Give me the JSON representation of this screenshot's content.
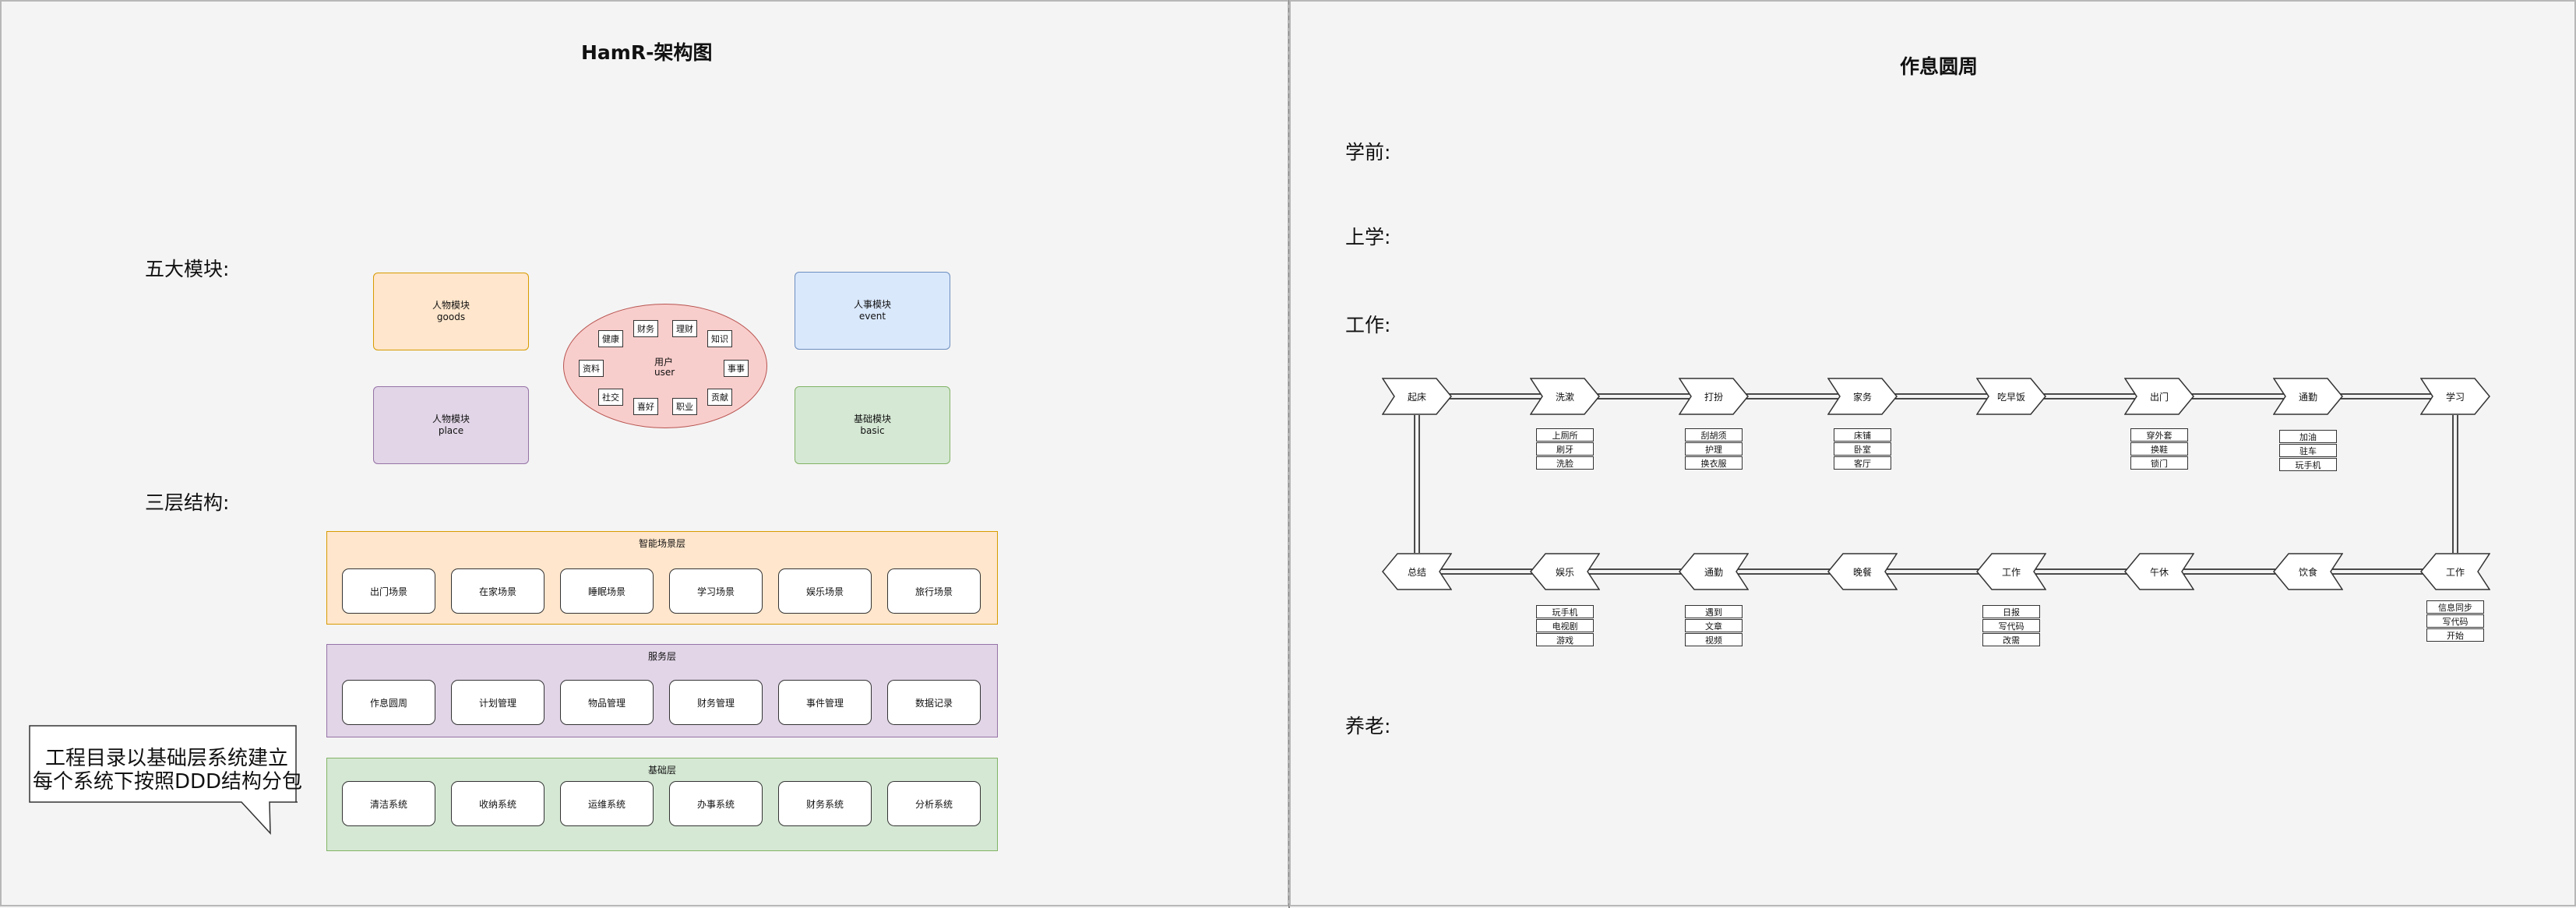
{
  "left_title": "HamR-架构图",
  "right_title": "作息圆周",
  "sections": {
    "modules": "五大模块:",
    "layers": "三层结构:",
    "pre_school": "学前:",
    "school": "上学:",
    "work": "工作:",
    "retire": "养老:"
  },
  "modules": {
    "goods": {
      "name": "人物模块",
      "sub": "goods"
    },
    "place": {
      "name": "人物模块",
      "sub": "place"
    },
    "event": {
      "name": "人事模块",
      "sub": "event"
    },
    "basic": {
      "name": "基础模块",
      "sub": "basic"
    },
    "user": {
      "name": "用户",
      "sub": "user"
    },
    "user_tags": [
      "健康",
      "财务",
      "理财",
      "知识",
      "资料",
      "事事",
      "社交",
      "喜好",
      "职业",
      "贡献"
    ]
  },
  "layers": {
    "scene": {
      "title": "智能场景层",
      "items": [
        "出门场景",
        "在家场景",
        "睡眠场景",
        "学习场景",
        "娱乐场景",
        "旅行场景"
      ]
    },
    "service": {
      "title": "服务层",
      "items": [
        "作息圆周",
        "计划管理",
        "物品管理",
        "财务管理",
        "事件管理",
        "数据记录"
      ]
    },
    "base": {
      "title": "基础层",
      "items": [
        "清洁系统",
        "收纳系统",
        "运维系统",
        "办事系统",
        "财务系统",
        "分析系统"
      ]
    }
  },
  "callout": {
    "line1": "工程目录以基础层系统建立",
    "line2": "每个系统下按照DDD结构分包"
  },
  "cycle": {
    "top": [
      "起床",
      "洗漱",
      "打扮",
      "家务",
      "吃早饭",
      "出门",
      "通勤",
      "学习"
    ],
    "bottom": [
      "总结",
      "娱乐",
      "通勤",
      "晚餐",
      "工作",
      "午休",
      "饮食",
      "工作"
    ],
    "top_tags": {
      "洗漱": [
        "上厕所",
        "刷牙",
        "洗脸"
      ],
      "打扮": [
        "刮胡须",
        "护理",
        "换衣服"
      ],
      "家务": [
        "床铺",
        "卧室",
        "客厅"
      ],
      "出门": [
        "穿外套",
        "换鞋",
        "锁门"
      ],
      "通勤": [
        "加油",
        "驻车",
        "玩手机"
      ]
    },
    "bottom_tags": {
      "娱乐": [
        "玩手机",
        "电视剧",
        "游戏"
      ],
      "通勤": [
        "遇到",
        "文章",
        "视频"
      ],
      "工作": [
        "日报",
        "写代码",
        "改需"
      ],
      "工作2": [
        "信息同步",
        "写代码",
        "开始"
      ]
    }
  },
  "colors": {
    "goods_fill": "#ffe6cc",
    "goods_stroke": "#d79b00",
    "place_fill": "#e1d5e7",
    "place_stroke": "#9673a6",
    "event_fill": "#dae8fc",
    "event_stroke": "#6c8ebf",
    "basic_fill": "#d5e8d4",
    "basic_stroke": "#82b366",
    "user_fill": "#f8cecc",
    "user_stroke": "#b85450"
  }
}
